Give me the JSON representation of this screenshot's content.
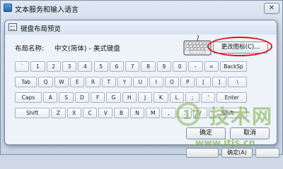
{
  "back_window": {
    "title": "文本服务和输入语言",
    "close_glyph": "✕",
    "bottom_buttons": [
      "",
      "确定(A)",
      ""
    ]
  },
  "dialog": {
    "title": "键盘布局预览",
    "layout_label": "布局名称:",
    "layout_value": "中文(简体) - 美式键盘",
    "change_icon_label": "更改图标(C)...",
    "ok_label": "确定",
    "cancel_label": "取消"
  },
  "keyboard": {
    "rows": [
      [
        "`",
        "1",
        "2",
        "3",
        "4",
        "5",
        "6",
        "7",
        "8",
        "9",
        "0",
        "-",
        "=",
        "BackSp"
      ],
      [
        "Tab",
        "Q",
        "W",
        "E",
        "R",
        "T",
        "Y",
        "U",
        "I",
        "O",
        "P",
        "[",
        "]",
        "\\"
      ],
      [
        "Caps",
        "A",
        "S",
        "D",
        "F",
        "G",
        "H",
        "J",
        "K",
        "L",
        ";",
        "'",
        "Enter"
      ],
      [
        "Shift",
        "Z",
        "X",
        "C",
        "V",
        "B",
        "N",
        "M",
        ",",
        ".",
        "/",
        "Shift"
      ]
    ]
  },
  "watermark": {
    "title": "技术网",
    "url": "www.itjs.cn"
  },
  "colors": {
    "highlight_ellipse": "#e0141a",
    "watermark_green": "#78aa3c"
  },
  "icons": {
    "dialog_icon": "keyboard-small-icon",
    "preview_icon": "keyboard-icon",
    "app_icon": "language-app-icon"
  }
}
